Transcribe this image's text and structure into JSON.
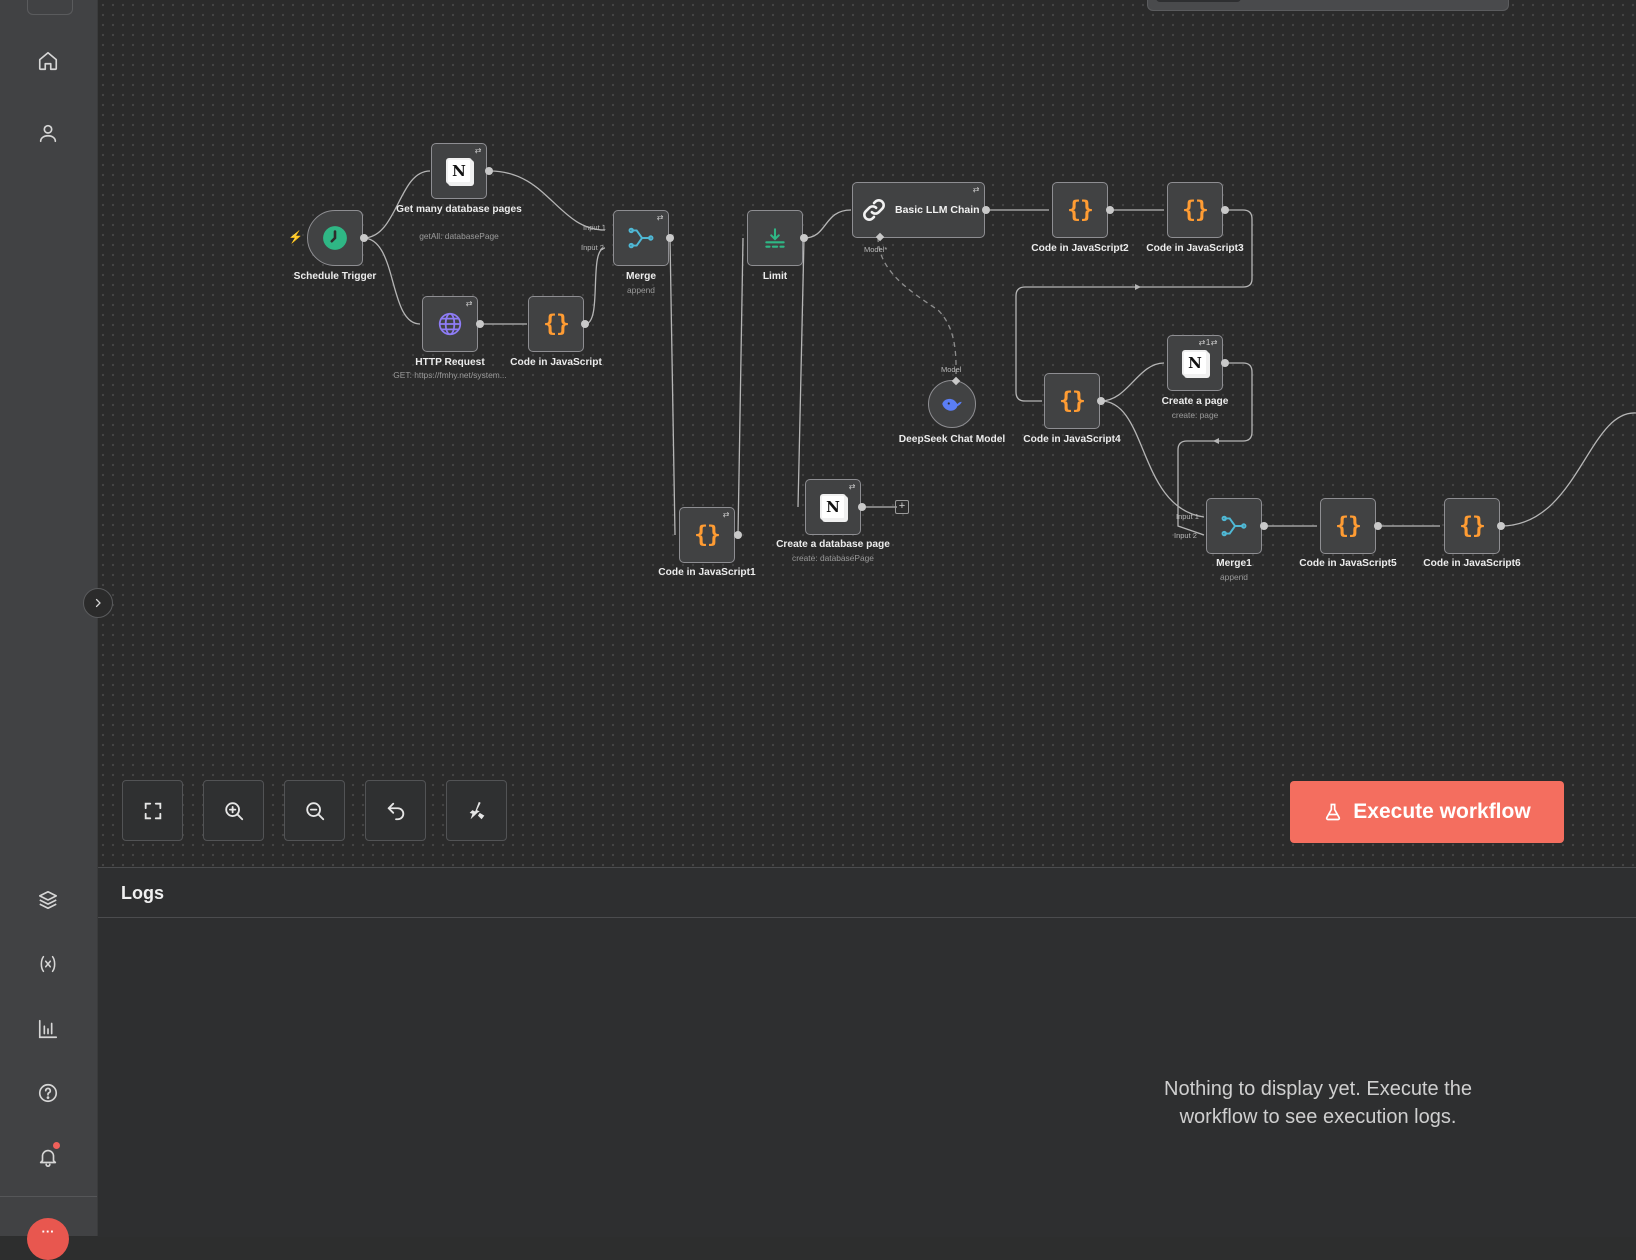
{
  "colors": {
    "accent": "#f46e5f",
    "code_icon": "#ff9c33",
    "trigger_icon": "#2fb785",
    "merge_icon": "#4fb9d6",
    "http_icon": "#8e7cf6",
    "notification_dot": "#f0605a"
  },
  "sidebar": {
    "top_items": [
      {
        "name": "home",
        "icon": "home-icon"
      },
      {
        "name": "personal",
        "icon": "user-icon"
      }
    ],
    "bottom_items": [
      {
        "name": "templates",
        "icon": "cube-icon"
      },
      {
        "name": "variables",
        "icon": "variables-icon"
      },
      {
        "name": "insights",
        "icon": "bar-chart-icon"
      },
      {
        "name": "help",
        "icon": "help-circle-icon"
      },
      {
        "name": "notifications",
        "icon": "bell-icon",
        "has_unread": true
      }
    ]
  },
  "nodes": {
    "schedule_trigger": {
      "label": "Schedule Trigger"
    },
    "get_many": {
      "label": "Get many database pages",
      "sub": "getAll: databasePage"
    },
    "http_request": {
      "label": "HTTP Request",
      "sub": "GET: https://fmhy.net/system..."
    },
    "code_js": {
      "label": "Code in JavaScript"
    },
    "merge": {
      "label": "Merge",
      "sub": "append",
      "input1": "Input 1",
      "input2": "Input 2"
    },
    "code_js1": {
      "label": "Code in JavaScript1"
    },
    "limit": {
      "label": "Limit"
    },
    "create_db_page": {
      "label": "Create a database page",
      "sub": "create: databasePage"
    },
    "llm_chain": {
      "label": "Basic LLM Chain",
      "port": "Model*"
    },
    "deepseek": {
      "label": "DeepSeek Chat Model",
      "port": "Model"
    },
    "code_js2": {
      "label": "Code in JavaScript2"
    },
    "code_js3": {
      "label": "Code in JavaScript3"
    },
    "code_js4": {
      "label": "Code in JavaScript4"
    },
    "create_page": {
      "label": "Create a page",
      "sub": "create: page",
      "badge": "1"
    },
    "merge1": {
      "label": "Merge1",
      "sub": "append",
      "input1": "Input 1",
      "input2": "Input 2"
    },
    "code_js5": {
      "label": "Code in JavaScript5"
    },
    "code_js6": {
      "label": "Code in JavaScript6"
    }
  },
  "toolbar": {
    "buttons": [
      {
        "name": "fit-view",
        "icon": "fullscreen-icon"
      },
      {
        "name": "zoom-in",
        "icon": "zoom-in-icon"
      },
      {
        "name": "zoom-out",
        "icon": "zoom-out-icon"
      },
      {
        "name": "undo",
        "icon": "undo-icon"
      },
      {
        "name": "tidy-up",
        "icon": "broom-icon"
      }
    ],
    "execute_label": "Execute workflow"
  },
  "logs": {
    "title": "Logs",
    "empty_message": "Nothing to display yet. Execute the workflow to see execution logs."
  }
}
